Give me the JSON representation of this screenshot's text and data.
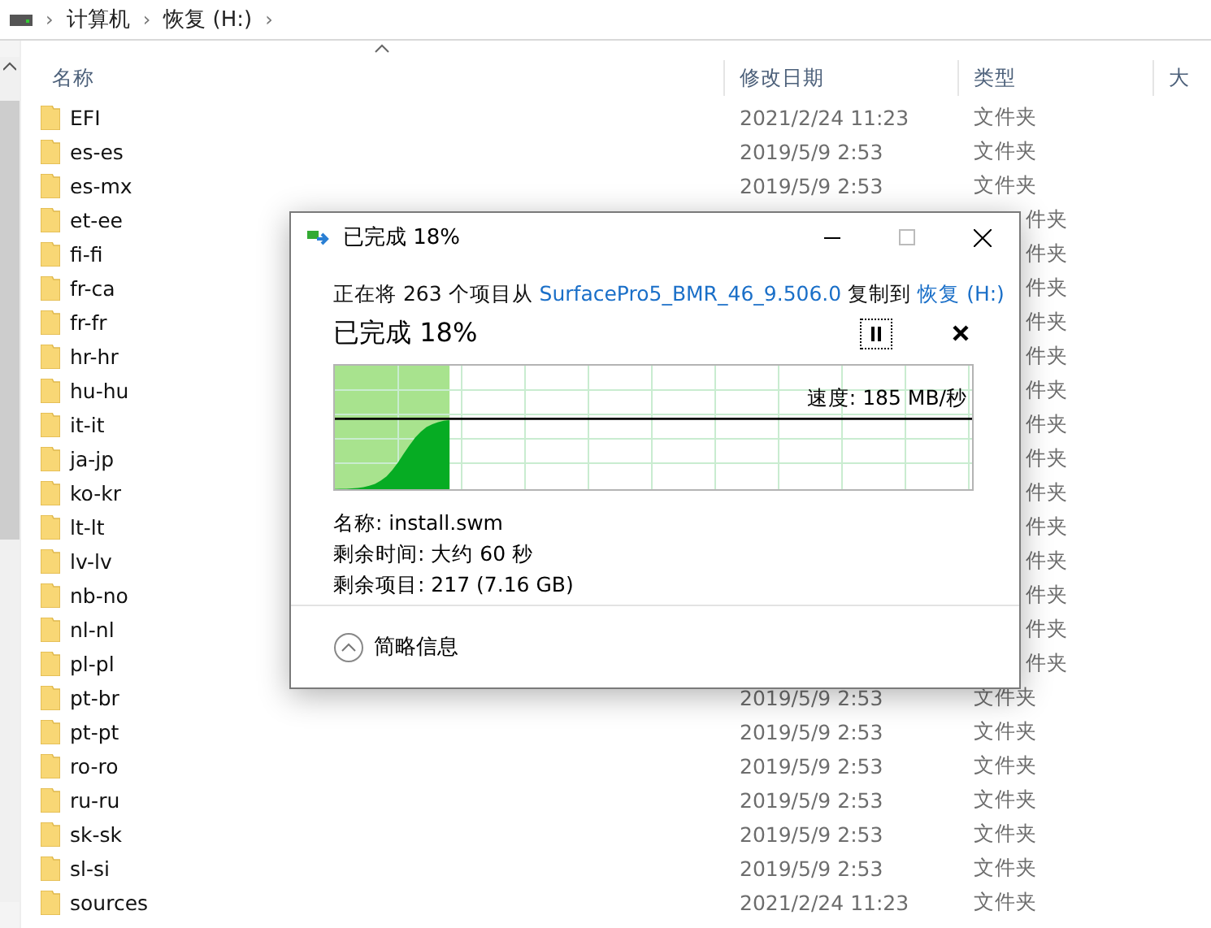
{
  "address_bar": {
    "path": [
      "计算机",
      "恢复 (H:)"
    ],
    "separator": "›"
  },
  "columns": [
    "名称",
    "修改日期",
    "类型",
    "大"
  ],
  "files": [
    {
      "name": "EFI",
      "modified": "2021/2/24 11:23",
      "type": "文件夹"
    },
    {
      "name": "es-es",
      "modified": "2019/5/9 2:53",
      "type": "文件夹"
    },
    {
      "name": "es-mx",
      "modified": "2019/5/9 2:53",
      "type": "文件夹"
    },
    {
      "name": "et-ee",
      "type": "件夹"
    },
    {
      "name": "fi-fi",
      "type": "件夹"
    },
    {
      "name": "fr-ca",
      "type": "件夹"
    },
    {
      "name": "fr-fr",
      "type": "件夹"
    },
    {
      "name": "hr-hr",
      "type": "件夹"
    },
    {
      "name": "hu-hu",
      "type": "件夹"
    },
    {
      "name": "it-it",
      "type": "件夹"
    },
    {
      "name": "ja-jp",
      "type": "件夹"
    },
    {
      "name": "ko-kr",
      "type": "件夹"
    },
    {
      "name": "lt-lt",
      "type": "件夹"
    },
    {
      "name": "lv-lv",
      "type": "件夹"
    },
    {
      "name": "nb-no",
      "type": "件夹"
    },
    {
      "name": "nl-nl",
      "type": "件夹"
    },
    {
      "name": "pl-pl",
      "type": "件夹"
    },
    {
      "name": "pt-br",
      "modified": "2019/5/9 2:53",
      "type": "文件夹"
    },
    {
      "name": "pt-pt",
      "modified": "2019/5/9 2:53",
      "type": "文件夹"
    },
    {
      "name": "ro-ro",
      "modified": "2019/5/9 2:53",
      "type": "文件夹"
    },
    {
      "name": "ru-ru",
      "modified": "2019/5/9 2:53",
      "type": "文件夹"
    },
    {
      "name": "sk-sk",
      "modified": "2019/5/9 2:53",
      "type": "文件夹"
    },
    {
      "name": "sl-si",
      "modified": "2019/5/9 2:53",
      "type": "文件夹"
    },
    {
      "name": "sources",
      "modified": "2021/2/24 11:23",
      "type": "文件夹"
    }
  ],
  "dialog": {
    "title": "已完成 18%",
    "copy_line": {
      "prefix": "正在将 263 个项目从",
      "source": "SurfacePro5_BMR_46_9.506.0",
      "middle": "复制到",
      "target": "恢复 (H:)"
    },
    "heading": "已完成 18%",
    "progress": {
      "level": 0.18
    },
    "speed": "速度: 185 MB/秒",
    "details": [
      "名称: install.swm",
      "剩余时间: 大约 60 秒",
      "剩余项目: 217 (7.16 GB)"
    ],
    "toggle": "简略信息"
  }
}
